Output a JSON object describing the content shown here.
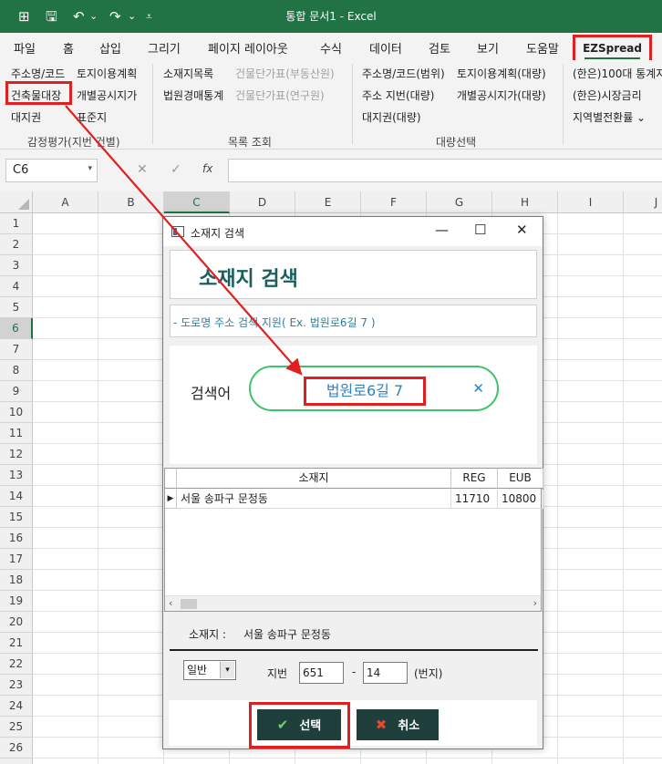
{
  "app": {
    "title": "통합 문서1  -  Excel",
    "qat": {
      "autosave": "⊞",
      "save": "🖫",
      "undo": "↶",
      "undo_dd": "⌄",
      "redo": "↷",
      "redo_dd": "⌄",
      "customize": "⩡"
    }
  },
  "ribbon": {
    "tabs": [
      "파일",
      "홈",
      "삽입",
      "그리기",
      "페이지 레이아웃",
      "수식",
      "데이터",
      "검토",
      "보기",
      "도움말"
    ],
    "active_tab": "EZSpread",
    "group1": {
      "items": [
        "주소명/코드",
        "토지이용계획",
        "건축물대장",
        "개별공시지가",
        "대지권",
        "표준지"
      ],
      "label": "감정평가(지번 건별)"
    },
    "group2": {
      "items": [
        "소재지목록",
        "건물단가표(부동산원)",
        "법원경매통계",
        "건물단가표(연구원)"
      ],
      "label": "목록 조회"
    },
    "group3": {
      "items": [
        "주소명/코드(범위)",
        "토지이용계획(대량)",
        "주소 지번(대량)",
        "개별공시지가(대량)",
        "대지권(대량)"
      ],
      "label": "대량선택"
    },
    "group4": {
      "items": [
        "(한은)100대 통계지",
        "(한은)시장금리",
        "지역별전환률 ⌄"
      ]
    }
  },
  "formula_bar": {
    "name_box": "C6",
    "name_dd": "▾",
    "cancel": "✕",
    "enter": "✓",
    "fx": "fx",
    "formula": ""
  },
  "grid": {
    "columns": [
      "A",
      "B",
      "C",
      "D",
      "E",
      "F",
      "G",
      "H",
      "I",
      "J"
    ],
    "selected_column": "C",
    "rows": [
      "1",
      "2",
      "3",
      "4",
      "5",
      "6",
      "7",
      "8",
      "9",
      "10",
      "11",
      "12",
      "13",
      "14",
      "15",
      "16",
      "17",
      "18",
      "19",
      "20",
      "21",
      "22",
      "23",
      "24",
      "25",
      "26",
      "27"
    ],
    "selected_row": "6"
  },
  "dialog": {
    "title": "소재지 검색",
    "win_min": "—",
    "win_max": "☐",
    "win_close": "✕",
    "header": "소재지 검색",
    "hint": "- 도로명 주소 검색 지원( Ex. 법원로6길 7 )",
    "search_label": "검색어",
    "search_value": "법원로6길 7",
    "clear": "✕",
    "table": {
      "columns": [
        "소재지",
        "REG",
        "EUB"
      ],
      "rows": [
        {
          "location": "서울 송파구 문정동",
          "reg": "11710",
          "eub": "10800"
        }
      ],
      "row_indicator": "▶",
      "scroll_left": "‹",
      "scroll_right": "›"
    },
    "selected_location_label": "소재지 :",
    "selected_location_value": "서울 송파구 문정동",
    "jibun": {
      "type": "일반",
      "type_dd": "▾",
      "label": "지번",
      "main": "651",
      "dash": "-",
      "sub": "14",
      "unit": "(번지)"
    },
    "buttons": {
      "select_icon": "✔",
      "select": "선택",
      "cancel_icon": "✖",
      "cancel": "취소"
    }
  },
  "colors": {
    "excel_green": "#217346",
    "highlight_red": "#e02020",
    "header_teal": "#1a5f5f",
    "button_dark": "#1f3f3d",
    "link_blue": "#2c83c4",
    "pill_green": "#3cc46a"
  }
}
